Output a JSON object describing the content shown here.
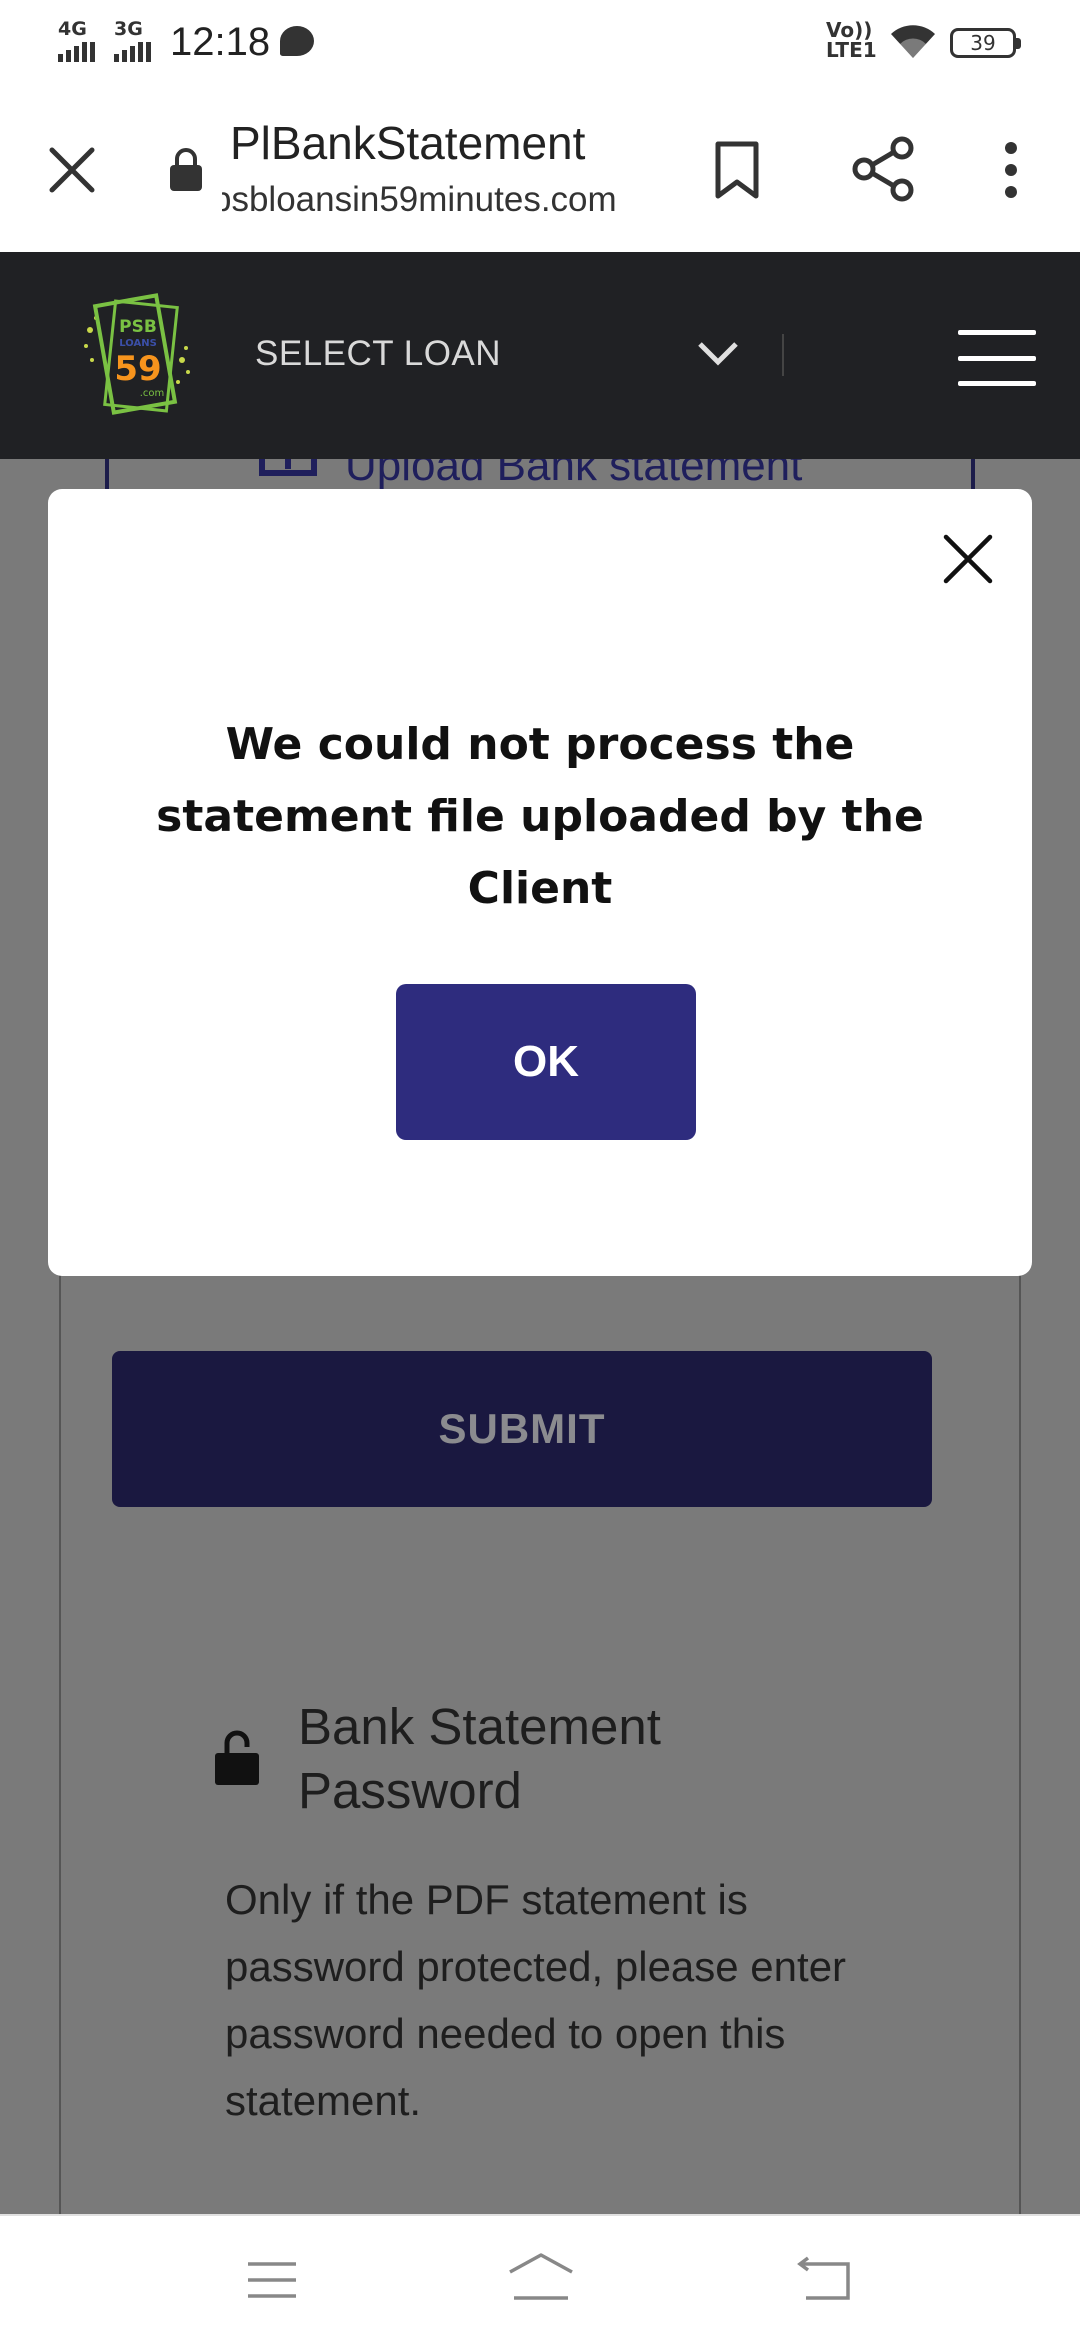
{
  "status_bar": {
    "network_1": "4G",
    "network_2": "3G",
    "time": "12:18",
    "volte_line1": "Vo))",
    "volte_line2": "LTE1",
    "battery": "39"
  },
  "browser": {
    "page_title": "PlBankStatement",
    "url": "psbloansin59minutes.com",
    "icons": [
      "close-icon",
      "lock-icon",
      "bookmark-icon",
      "share-icon",
      "more-vert-icon"
    ]
  },
  "header": {
    "logo_text_top": "PSB",
    "logo_text_mid": "LOANS",
    "logo_number": "59",
    "logo_text_bottom": ".com",
    "select_label": "SELECT LOAN",
    "brand_color": "#202124"
  },
  "background_page": {
    "upload_label": "Upload Bank statement",
    "submit_label": "SUBMIT",
    "password_title": "Bank Statement Password",
    "password_description": "Only if the PDF statement is password protected, please enter password needed to open this statement."
  },
  "modal": {
    "message": "We could not process the statement file uploaded by the Client",
    "ok_label": "OK",
    "accent_color": "#2e2c7e"
  },
  "nav_bar": {
    "icons": [
      "menu-icon",
      "home-icon",
      "back-icon"
    ]
  }
}
